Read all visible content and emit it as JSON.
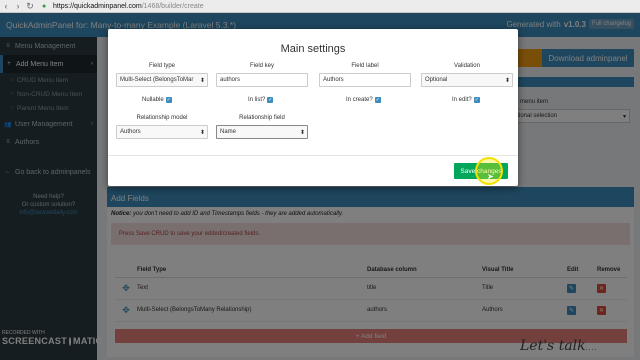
{
  "browser": {
    "url_host": "https://quickadminpanel.com",
    "url_path": "/1468/builder/create"
  },
  "header": {
    "title": "QuickAdminPanel for: Many-to-many Example (Laravel 5.3.*)",
    "generated_prefix": "Generated with",
    "version": "v1.0.3",
    "badge": "Full changelog"
  },
  "sidebar": {
    "items": [
      {
        "label": "Menu Management",
        "icon": "list-icon"
      },
      {
        "label": "Add Menu Item",
        "icon": "plus-icon",
        "active": true
      },
      {
        "label": "CRUD Menu Item",
        "icon": "circle-icon",
        "sub": true
      },
      {
        "label": "Non-CRUD Menu Item",
        "icon": "circle-icon",
        "sub": true
      },
      {
        "label": "Parent Menu Item",
        "icon": "circle-icon",
        "sub": true
      },
      {
        "label": "User Management",
        "icon": "users-icon"
      },
      {
        "label": "Authors",
        "icon": "user-icon"
      },
      {
        "label": "Go back to adminpanels",
        "icon": "arrow-left-icon"
      }
    ],
    "help_line1": "Need help?",
    "help_line2": "Or custom solution?",
    "help_email": "info@laraveldaily.com"
  },
  "main": {
    "download_label": "Download adminpanel",
    "parent_menu_label": "ent menu item",
    "parent_menu_value": "ptional selection",
    "add_fields_title": "Add Fields",
    "notice_prefix": "Notice:",
    "notice_text": "you don't need to add ID and Timestamps fields - they are added automatically.",
    "alert_text": "Press Save CRUD to save your edited/created fields.",
    "table_headers": [
      "Field Type",
      "Database column",
      "Visual Title",
      "Edit",
      "Remove"
    ],
    "rows": [
      {
        "type": "Text",
        "column": "title",
        "visual": "Title"
      },
      {
        "type": "Multi-Select (BelongsToMany Relationship)",
        "column": "authors",
        "visual": "Authors"
      }
    ],
    "add_field_label": "+ Add field"
  },
  "modal": {
    "title": "Main settings",
    "field_type_label": "Field type",
    "field_type_value": "Multi-Select (BelongsToMar",
    "field_key_label": "Field key",
    "field_key_value": "authors",
    "field_label_label": "Field label",
    "field_label_value": "Authors",
    "validation_label": "Validation",
    "validation_value": "Optional",
    "nullable_label": "Nullable",
    "in_list_label": "In list?",
    "in_create_label": "In create?",
    "in_edit_label": "In edit?",
    "relationship_model_label": "Relationship model",
    "relationship_model_value": "Authors",
    "relationship_field_label": "Relationship field",
    "relationship_field_value": "Name",
    "save_label": "Save changes"
  },
  "watermark": {
    "recorded_with": "RECORDED WITH",
    "screencast_left": "SCREENCAST",
    "screencast_right": "MATIC",
    "signature": "Let's talk"
  }
}
